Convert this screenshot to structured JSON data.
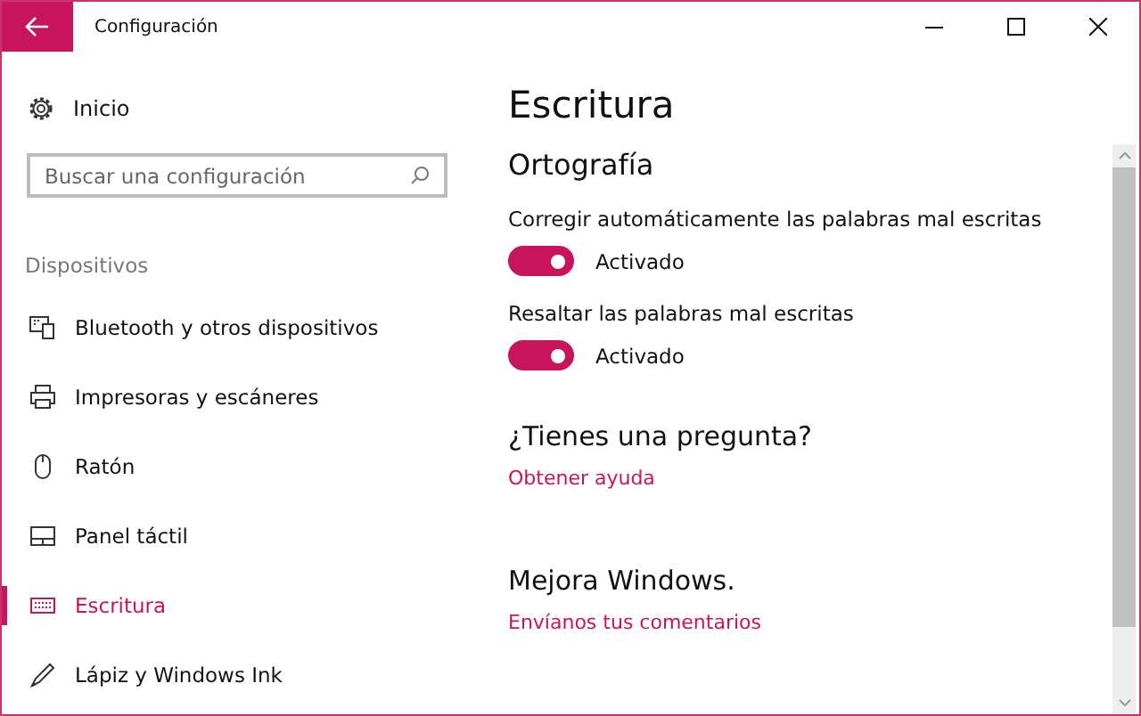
{
  "window": {
    "title": "Configuración"
  },
  "sidebar": {
    "home": {
      "label": "Inicio"
    },
    "search": {
      "placeholder": "Buscar una configuración"
    },
    "section": "Dispositivos",
    "items": [
      {
        "label": "Bluetooth y otros dispositivos",
        "kind": "bluetooth",
        "selected": false
      },
      {
        "label": "Impresoras y escáneres",
        "kind": "printer",
        "selected": false
      },
      {
        "label": "Ratón",
        "kind": "mouse",
        "selected": false
      },
      {
        "label": "Panel táctil",
        "kind": "touchpad",
        "selected": false
      },
      {
        "label": "Escritura",
        "kind": "keyboard",
        "selected": true
      },
      {
        "label": "Lápiz y Windows Ink",
        "kind": "pen",
        "selected": false
      }
    ]
  },
  "content": {
    "title": "Escritura",
    "section": "Ortografía",
    "settings": [
      {
        "label": "Corregir automáticamente las palabras mal escritas",
        "on": true,
        "state": "Activado"
      },
      {
        "label": "Resaltar las palabras mal escritas",
        "on": true,
        "state": "Activado"
      }
    ],
    "help": [
      {
        "heading": "¿Tienes una pregunta?",
        "link": "Obtener ayuda"
      },
      {
        "heading": "Mejora Windows.",
        "link": "Envíanos tus comentarios"
      }
    ]
  }
}
